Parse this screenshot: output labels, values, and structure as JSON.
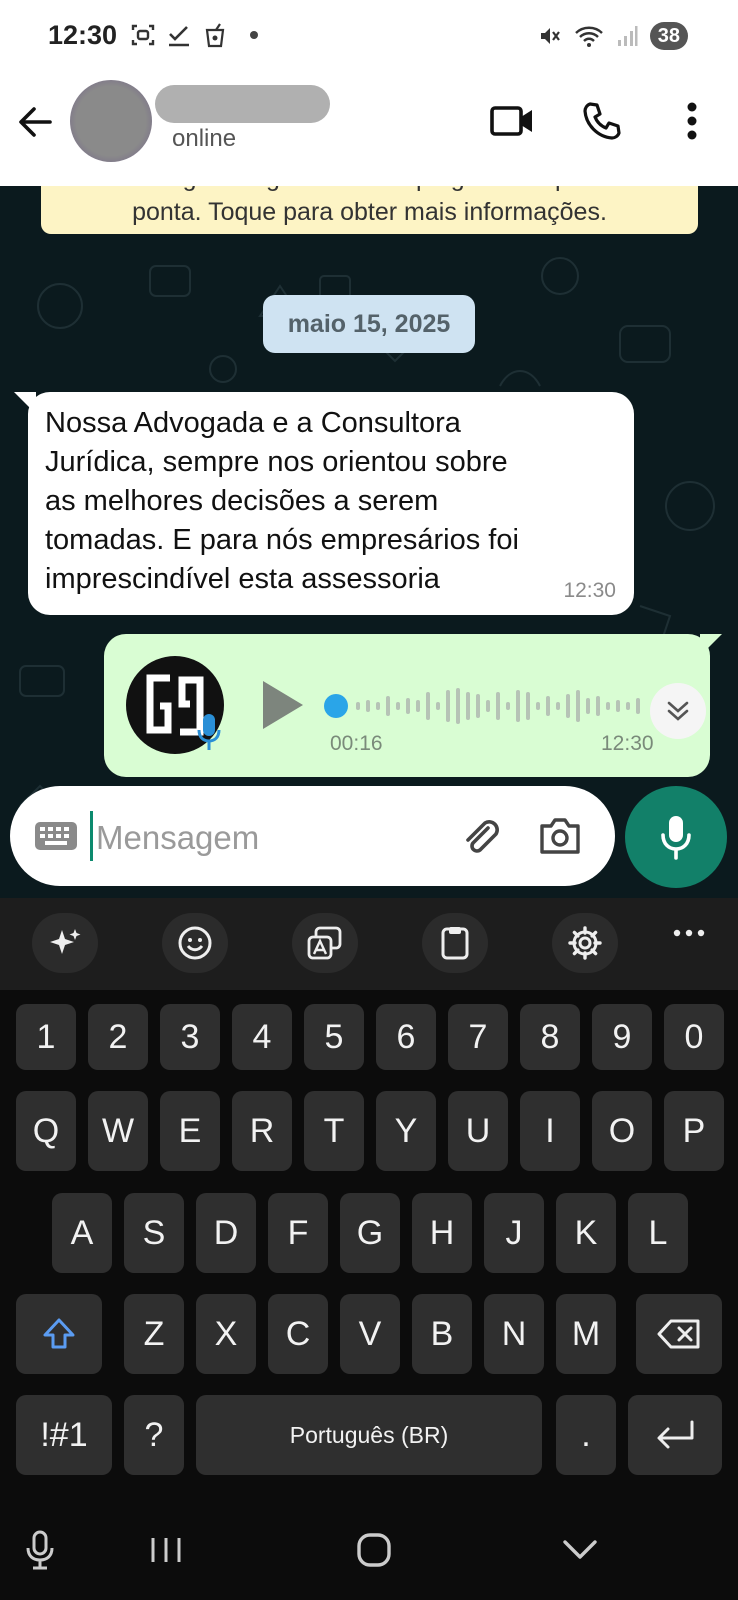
{
  "status_bar": {
    "time": "12:30",
    "battery": "38"
  },
  "header": {
    "contact_name": "",
    "contact_status": "online"
  },
  "chat": {
    "encryption_notice": {
      "line1": "estão agora seguras com criptografia de ponta a",
      "line2": "ponta. Toque para obter mais informações."
    },
    "date_separator": "maio 15, 2025",
    "incoming_message": {
      "lines": [
        "Nossa Advogada e a Consultora",
        "Jurídica, sempre nos orientou sobre",
        "as melhores decisões a serem",
        "tomadas. E para nós empresários foi",
        "imprescindível esta assessoria"
      ],
      "time": "12:30"
    },
    "voice_message": {
      "duration": "00:16",
      "time": "12:30"
    }
  },
  "composer": {
    "placeholder": "Mensagem"
  },
  "keyboard": {
    "number_row": [
      "1",
      "2",
      "3",
      "4",
      "5",
      "6",
      "7",
      "8",
      "9",
      "0"
    ],
    "row1": [
      "Q",
      "W",
      "E",
      "R",
      "T",
      "Y",
      "U",
      "I",
      "O",
      "P"
    ],
    "row2": [
      "A",
      "S",
      "D",
      "F",
      "G",
      "H",
      "J",
      "K",
      "L"
    ],
    "row3": [
      "Z",
      "X",
      "C",
      "V",
      "B",
      "N",
      "M"
    ],
    "symbols_key": "!#1",
    "question_key": "?",
    "space_label": "Português (BR)",
    "period_key": "."
  },
  "colors": {
    "accent": "#128069",
    "chat_bg": "#0b1a1e",
    "outgoing_bubble": "#d9fdd3",
    "date_pill": "#cfe3f2"
  }
}
